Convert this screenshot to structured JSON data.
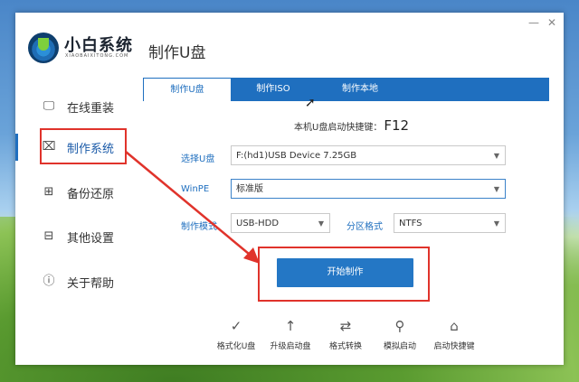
{
  "app": {
    "name": "小白系统",
    "subtitle": "XIAOBAIXITONG.COM",
    "page_title": "制作U盘"
  },
  "window_controls": {
    "minimize": "—",
    "close": "✕"
  },
  "sidebar": {
    "items": [
      {
        "label": "在线重装",
        "icon": "monitor-icon",
        "glyph": "🖵"
      },
      {
        "label": "制作系统",
        "icon": "usb-icon",
        "glyph": "⌧",
        "active": true
      },
      {
        "label": "备份还原",
        "icon": "grid-icon",
        "glyph": "⊞"
      },
      {
        "label": "其他设置",
        "icon": "briefcase-icon",
        "glyph": "⊟"
      },
      {
        "label": "关于帮助",
        "icon": "info-icon",
        "glyph": "ⓘ"
      }
    ]
  },
  "tabs": [
    {
      "label": "制作U盘",
      "active": true
    },
    {
      "label": "制作ISO"
    },
    {
      "label": "制作本地"
    }
  ],
  "hotkey": {
    "label": "本机U盘启动快捷键：",
    "key": "F12"
  },
  "form": {
    "usb_label": "选择U盘",
    "usb_value": "F:(hd1)USB Device 7.25GB",
    "winpe_label": "WinPE",
    "winpe_value": "标准版",
    "mode_label": "制作模式",
    "mode_value": "USB-HDD",
    "partition_label": "分区格式",
    "partition_value": "NTFS"
  },
  "start_button": "开始制作",
  "tools": [
    {
      "label": "格式化U盘",
      "icon": "check-circle-icon",
      "glyph": "✓"
    },
    {
      "label": "升级启动盘",
      "icon": "upload-circle-icon",
      "glyph": "↑"
    },
    {
      "label": "格式转换",
      "icon": "convert-icon",
      "glyph": "⇄"
    },
    {
      "label": "模拟启动",
      "icon": "simulate-icon",
      "glyph": "⚲"
    },
    {
      "label": "启动快捷键",
      "icon": "mouse-icon",
      "glyph": "⌂"
    }
  ],
  "colors": {
    "accent": "#1f6fbf",
    "highlight": "#e0332b"
  }
}
